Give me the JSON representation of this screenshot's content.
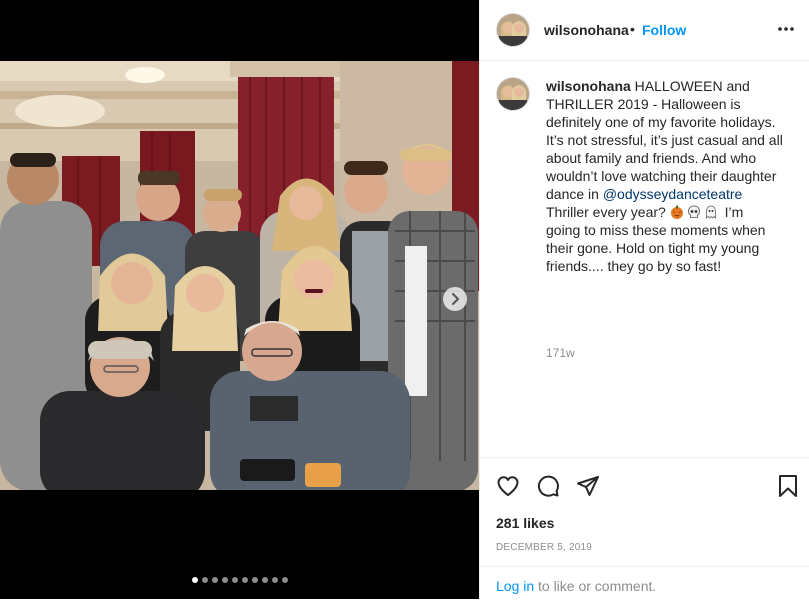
{
  "post": {
    "username": "wilsonohana",
    "separator": "•",
    "follow_label": "Follow",
    "caption": {
      "line1_rest": " HALLOWEEN and",
      "line2": "THRILLER 2019 - Halloween is",
      "line3": "definitely one of my favorite holidays.",
      "line4": "It’s not stressful, it’s just casual and all",
      "line5": "about family and friends. And who",
      "line6": "wouldn’t love watching their daughter",
      "line7_pre": "dance in ",
      "mention": "@odysseydanceteatre",
      "line8_pre": "Thriller every year? ",
      "line8_post": " I’m",
      "line9": "going to miss these moments when",
      "line10": "their gone. Hold on tight my young",
      "line11": "friends.... they go by so fast!"
    },
    "emojis": [
      "jack-o-lantern-icon",
      "skull-icon",
      "ghost-icon"
    ],
    "time_ago": "171w",
    "likes": "281 likes",
    "date": "DECEMBER 5, 2019",
    "login_label": "Log in",
    "login_rest": " to like or comment."
  },
  "carousel": {
    "count": 10,
    "active_index": 0
  },
  "colors": {
    "link": "#0095f6",
    "mention": "#00376b",
    "muted": "#8e8e8e",
    "text": "#262626",
    "border": "#efefef"
  }
}
